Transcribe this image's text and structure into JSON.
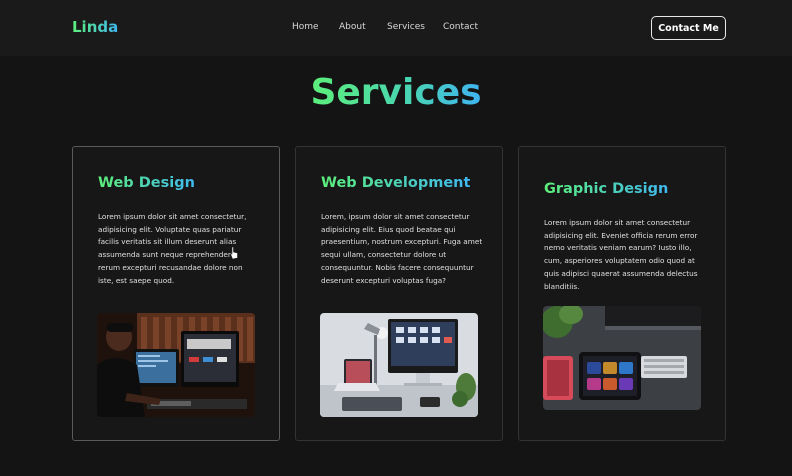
{
  "nav": {
    "logo": "Linda",
    "links": [
      "Home",
      "About",
      "Services",
      "Contact"
    ],
    "cta": "Contact Me"
  },
  "section": {
    "title": "Services"
  },
  "cards": [
    {
      "title": "Web Design",
      "text": "Lorem ipsum dolor sit amet consectetur, adipisicing elit. Voluptate quas pariatur facilis veritatis sit illum deserunt alias assumenda sunt neque reprehenderit rerum excepturi recusandae dolore non iste, est saepe quod.",
      "image": "developer-at-desk-photo"
    },
    {
      "title": "Web Development",
      "text": "Lorem, ipsum dolor sit amet consectetur adipisicing elit. Eius quod beatae qui praesentium, nostrum excepturi. Fuga amet sequi ullam, consectetur dolore ut consequuntur. Nobis facere consequuntur deserunt excepturi voluptas fuga?",
      "image": "imac-workspace-photo"
    },
    {
      "title": "Graphic Design",
      "text": "Lorem ipsum dolor sit amet consectetur adipisicing elit. Eveniet officia rerum error nemo veritatis veniam earum? Iusto illo, cum, asperiores voluptatem odio quod at quis adipisci quaerat assumenda delectus blanditiis.",
      "image": "design-tablet-photo"
    }
  ],
  "colors": {
    "gradient_start": "#5cf07a",
    "gradient_end": "#3fb8f0",
    "background": "#141414",
    "card_background": "#171717"
  }
}
